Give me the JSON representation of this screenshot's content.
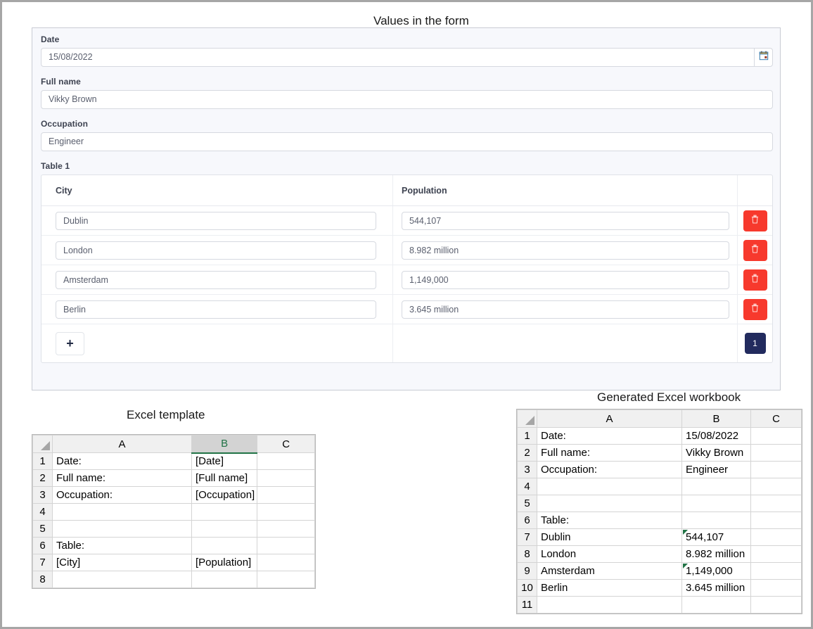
{
  "captions": {
    "form": "Values in the form",
    "template": "Excel template",
    "generated": "Generated Excel workbook"
  },
  "form": {
    "fields": [
      {
        "label": "Date",
        "value": "15/08/2022",
        "icon": "calendar-icon"
      },
      {
        "label": "Full name",
        "value": "Vikky Brown"
      },
      {
        "label": "Occupation",
        "value": "Engineer"
      }
    ],
    "table": {
      "label": "Table 1",
      "headers": [
        "City",
        "Population"
      ],
      "rows": [
        {
          "city": "Dublin",
          "population": "544,107"
        },
        {
          "city": "London",
          "population": "8.982 million"
        },
        {
          "city": "Amsterdam",
          "population": "1,149,000"
        },
        {
          "city": "Berlin",
          "population": "3.645 million"
        }
      ],
      "add_label": "+",
      "page_label": "1",
      "delete_icon": "trash-icon"
    }
  },
  "excel_template": {
    "columns": [
      "A",
      "B",
      "C"
    ],
    "selected_column": "B",
    "rows": [
      {
        "n": "1",
        "a": "Date:",
        "b": "[Date]",
        "c": ""
      },
      {
        "n": "2",
        "a": "Full name:",
        "b": "[Full name]",
        "c": ""
      },
      {
        "n": "3",
        "a": "Occupation:",
        "b": "[Occupation]",
        "c": ""
      },
      {
        "n": "4",
        "a": "",
        "b": "",
        "c": ""
      },
      {
        "n": "5",
        "a": "",
        "b": "",
        "c": ""
      },
      {
        "n": "6",
        "a": "Table:",
        "b": "",
        "c": ""
      },
      {
        "n": "7",
        "a": "[City]",
        "b": "[Population]",
        "c": ""
      },
      {
        "n": "8",
        "a": "",
        "b": "",
        "c": ""
      }
    ]
  },
  "excel_generated": {
    "columns": [
      "A",
      "B",
      "C"
    ],
    "rows": [
      {
        "n": "1",
        "a": "Date:",
        "b": "15/08/2022",
        "c": "",
        "flag": false
      },
      {
        "n": "2",
        "a": "Full name:",
        "b": "Vikky Brown",
        "c": "",
        "flag": false
      },
      {
        "n": "3",
        "a": "Occupation:",
        "b": "Engineer",
        "c": "",
        "flag": false
      },
      {
        "n": "4",
        "a": "",
        "b": "",
        "c": "",
        "flag": false
      },
      {
        "n": "5",
        "a": "",
        "b": "",
        "c": "",
        "flag": false
      },
      {
        "n": "6",
        "a": "Table:",
        "b": "",
        "c": "",
        "flag": false
      },
      {
        "n": "7",
        "a": "Dublin",
        "b": "544,107",
        "c": "",
        "flag": true
      },
      {
        "n": "8",
        "a": "London",
        "b": "8.982 million",
        "c": "",
        "flag": false
      },
      {
        "n": "9",
        "a": "Amsterdam",
        "b": "1,149,000",
        "c": "",
        "flag": true
      },
      {
        "n": "10",
        "a": "Berlin",
        "b": "3.645 million",
        "c": "",
        "flag": false
      },
      {
        "n": "11",
        "a": "",
        "b": "",
        "c": "",
        "flag": false
      }
    ]
  },
  "colors": {
    "panel_bg": "#f7f8fc",
    "delete_red": "#f7392d",
    "page_navy": "#222b5e",
    "excel_green": "#217346"
  }
}
